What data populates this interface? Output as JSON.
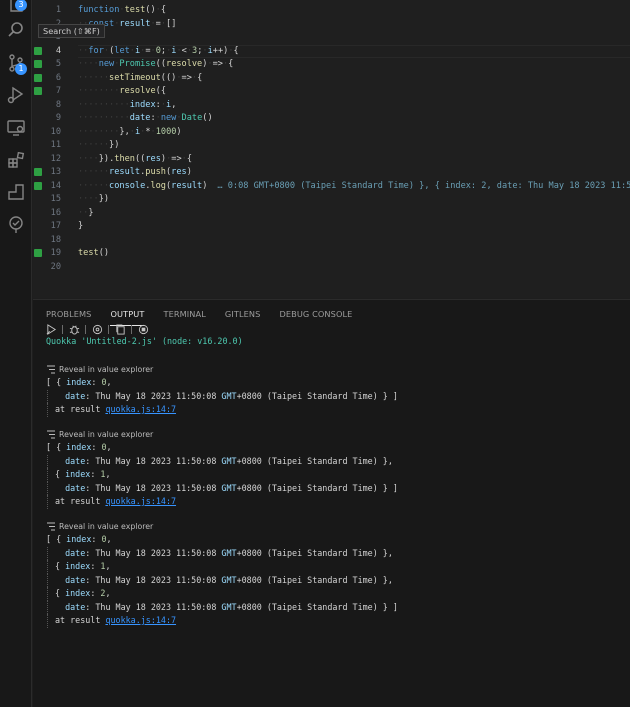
{
  "activity_bar": {
    "items": [
      {
        "name": "explorer-icon",
        "badge": "3"
      },
      {
        "name": "search-icon"
      },
      {
        "name": "source-control-icon",
        "badge": "1"
      },
      {
        "name": "run-debug-icon"
      },
      {
        "name": "remote-explorer-icon"
      },
      {
        "name": "extensions-icon"
      },
      {
        "name": "gitlens-icon"
      },
      {
        "name": "quokka-icon"
      }
    ]
  },
  "tooltip": {
    "text": "Search (⇧⌘F)"
  },
  "editor": {
    "current_line": 4,
    "inline_result": "… 0:08 GMT+0800 (Taipei Standard Time) }, { index: 2, date: Thu May 18 2023 11:50:08",
    "lines": [
      {
        "n": "1",
        "text": "function test() {"
      },
      {
        "n": "2",
        "text": "  const result = []"
      },
      {
        "n": "3",
        "text": ""
      },
      {
        "n": "4",
        "text": "  for (let i = 0; i < 3; i++) {"
      },
      {
        "n": "5",
        "text": "    new Promise((resolve) => {"
      },
      {
        "n": "6",
        "text": "      setTimeout(() => {"
      },
      {
        "n": "7",
        "text": "        resolve({"
      },
      {
        "n": "8",
        "text": "          index: i,"
      },
      {
        "n": "9",
        "text": "          date: new Date()"
      },
      {
        "n": "10",
        "text": "        }, i * 1000)"
      },
      {
        "n": "11",
        "text": "      })"
      },
      {
        "n": "12",
        "text": "    }).then((res) => {"
      },
      {
        "n": "13",
        "text": "      result.push(res)"
      },
      {
        "n": "14",
        "text": "      console.log(result)"
      },
      {
        "n": "15",
        "text": "    })"
      },
      {
        "n": "16",
        "text": "  }"
      },
      {
        "n": "17",
        "text": "}"
      },
      {
        "n": "18",
        "text": ""
      },
      {
        "n": "19",
        "text": "test()"
      },
      {
        "n": "20",
        "text": ""
      }
    ]
  },
  "panel": {
    "tabs": [
      "PROBLEMS",
      "OUTPUT",
      "TERMINAL",
      "GITLENS",
      "DEBUG CONSOLE"
    ],
    "active_tab": "OUTPUT",
    "quokka_header": "Quokka 'Untitled-2.js' (node: v16.20.0)",
    "reveal_label": "Reveal in value explorer",
    "at_result": "at result",
    "link": "quokka.js:14:7",
    "date_value": "Thu May 18 2023 11:50:08",
    "gmt": "GMT",
    "tz_offset": "+0800",
    "tz_name": "(Taipei Standard Time)",
    "logs": [
      {
        "indices": [
          "0"
        ]
      },
      {
        "indices": [
          "0",
          "1"
        ]
      },
      {
        "indices": [
          "0",
          "1",
          "2"
        ]
      }
    ]
  }
}
